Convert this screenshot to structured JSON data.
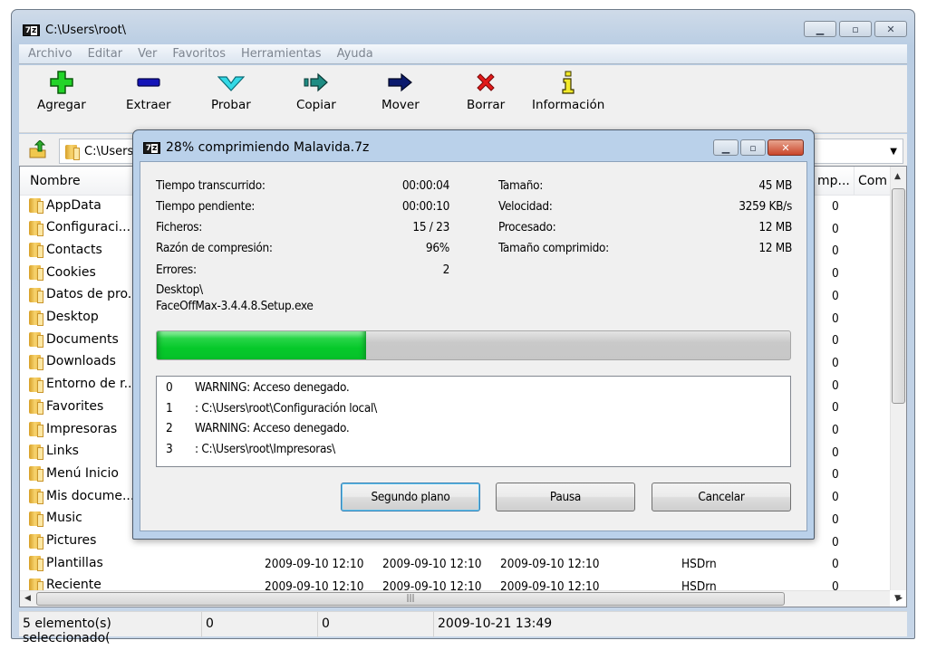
{
  "window": {
    "title": "C:\\Users\\root\\",
    "caption_buttons": [
      "minimize",
      "restore",
      "close"
    ]
  },
  "menubar": {
    "items": [
      "Archivo",
      "Editar",
      "Ver",
      "Favoritos",
      "Herramientas",
      "Ayuda"
    ]
  },
  "toolbar": {
    "buttons": [
      {
        "label": "Agregar",
        "icon": "plus-icon",
        "color": "#22d428"
      },
      {
        "label": "Extraer",
        "icon": "minus-icon",
        "color": "#1414b8"
      },
      {
        "label": "Probar",
        "icon": "check-chevron-icon",
        "color": "#33d9e6"
      },
      {
        "label": "Copiar",
        "icon": "copy-arrow-icon",
        "color": "#1e8c83"
      },
      {
        "label": "Mover",
        "icon": "move-arrow-icon",
        "color": "#0b1a6e"
      },
      {
        "label": "Borrar",
        "icon": "delete-x-icon",
        "color": "#e21b1b"
      },
      {
        "label": "Información",
        "icon": "info-icon",
        "color": "#f3ea2a"
      }
    ]
  },
  "address": {
    "path": "C:\\Users\\root\\"
  },
  "listview": {
    "columns": [
      "Nombre",
      "mp...",
      "Com"
    ],
    "rows": [
      {
        "name": "AppData",
        "last": "0"
      },
      {
        "name": "Configuraci...",
        "last": "0"
      },
      {
        "name": "Contacts",
        "last": "0"
      },
      {
        "name": "Cookies",
        "last": "0"
      },
      {
        "name": "Datos de pro...",
        "last": "0"
      },
      {
        "name": "Desktop",
        "last": "0"
      },
      {
        "name": "Documents",
        "last": "0"
      },
      {
        "name": "Downloads",
        "last": "0"
      },
      {
        "name": "Entorno de r...",
        "last": "0"
      },
      {
        "name": "Favorites",
        "last": "0"
      },
      {
        "name": "Impresoras",
        "last": "0"
      },
      {
        "name": "Links",
        "last": "0"
      },
      {
        "name": "Menú Inicio",
        "last": "0"
      },
      {
        "name": "Mis docume...",
        "last": "0"
      },
      {
        "name": "Music",
        "last": "0"
      },
      {
        "name": "Pictures",
        "last": "0"
      },
      {
        "name": "Plantillas",
        "modified": "2009-09-10 12:10",
        "created": "2009-09-10 12:10",
        "accessed": "2009-09-10 12:10",
        "attributes": "HSDrn",
        "last": "0"
      },
      {
        "name": "Reciente",
        "modified": "2009-09-10 12:10",
        "created": "2009-09-10 12:10",
        "accessed": "2009-09-10 12:10",
        "attributes": "HSDrn",
        "last": "0"
      }
    ]
  },
  "statusbar": {
    "selection": "5 elemento(s) seleccionado(",
    "size": "0",
    "packed": "0",
    "modified": "2009-10-21 13:49"
  },
  "dialog": {
    "title": "28% comprimiendo Malavida.7z",
    "left_stats": [
      {
        "label": "Tiempo transcurrido:",
        "value": "00:00:04"
      },
      {
        "label": "Tiempo pendiente:",
        "value": "00:00:10"
      },
      {
        "label": "Ficheros:",
        "value": "15 / 23"
      },
      {
        "label": "Razón de compresión:",
        "value": "96%"
      },
      {
        "label": "Errores:",
        "value": "2"
      }
    ],
    "right_stats": [
      {
        "label": "Tamaño:",
        "value": "45 MB"
      },
      {
        "label": "Velocidad:",
        "value": "3259 KB/s"
      },
      {
        "label": "Procesado:",
        "value": "12 MB"
      },
      {
        "label": "Tamaño comprimido:",
        "value": "12 MB"
      }
    ],
    "current_path": "Desktop\\",
    "current_file": "FaceOffMax-3.4.4.8.Setup.exe",
    "progress_fraction": 0.33,
    "progress_color": "#06c92a",
    "log": [
      {
        "index": "0",
        "text": "WARNING: Acceso denegado."
      },
      {
        "index": "1",
        "text": ": C:\\Users\\root\\Configuración local\\"
      },
      {
        "index": "2",
        "text": "WARNING: Acceso denegado."
      },
      {
        "index": "3",
        "text": ": C:\\Users\\root\\Impresoras\\"
      }
    ],
    "buttons": {
      "background": "Segundo plano",
      "pause": "Pausa",
      "cancel": "Cancelar"
    }
  }
}
